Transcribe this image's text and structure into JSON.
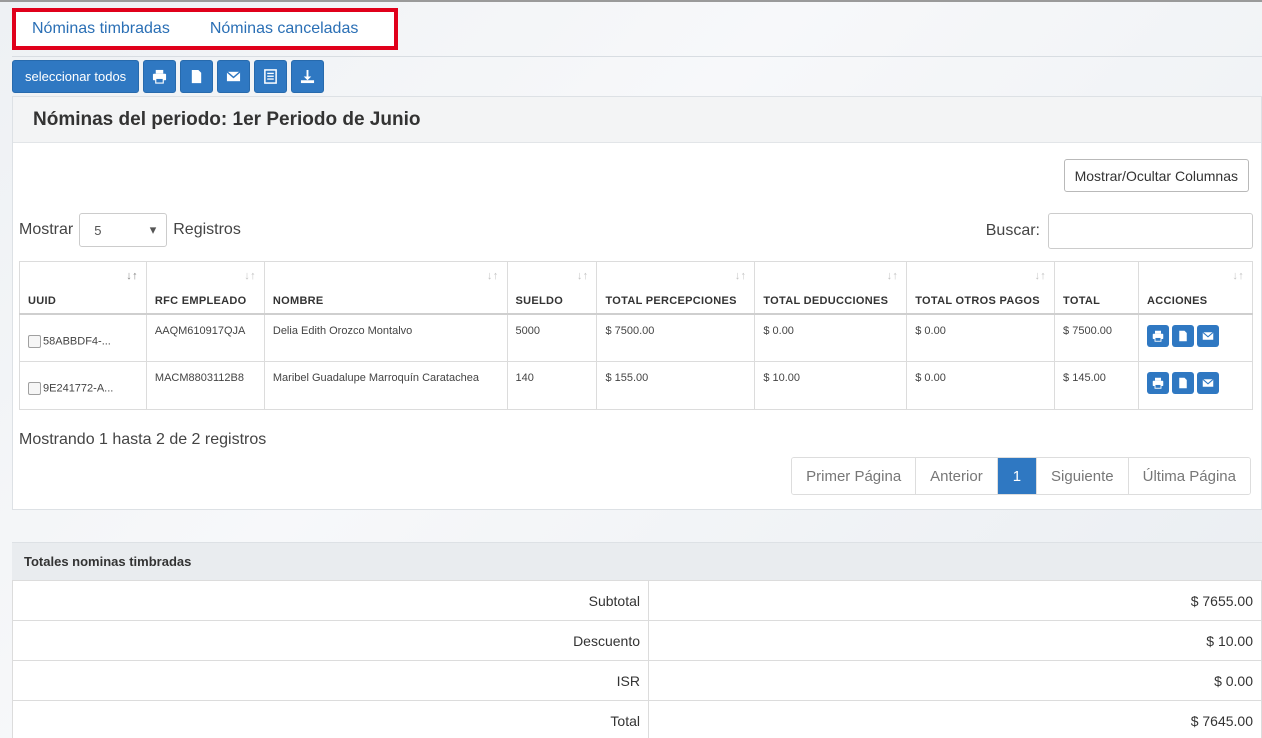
{
  "tabs": [
    {
      "label": "Nóminas timbradas"
    },
    {
      "label": "Nóminas canceladas"
    }
  ],
  "toolbar": {
    "select_all": "seleccionar todos",
    "icons": [
      "print-icon",
      "file-icon",
      "envelope-icon",
      "list-icon",
      "download-icon"
    ]
  },
  "panel": {
    "title": "Nóminas del periodo: 1er Periodo de Junio",
    "col_toggle": "Mostrar/Ocultar Columnas",
    "show_label": "Mostrar",
    "show_value": "5",
    "records_label": "Registros",
    "search_label": "Buscar:",
    "search_value": ""
  },
  "table": {
    "headers": [
      "UUID",
      "RFC EMPLEADO",
      "NOMBRE",
      "SUELDO",
      "TOTAL PERCEPCIONES",
      "TOTAL DEDUCCIONES",
      "TOTAL OTROS PAGOS",
      "TOTAL",
      "ACCIONES"
    ],
    "rows": [
      {
        "uuid": "58ABBDF4-...",
        "rfc": "AAQM610917QJA",
        "nombre": "Delia Edith Orozco Montalvo",
        "sueldo": "5000",
        "percepciones": "$ 7500.00",
        "deducciones": "$ 0.00",
        "otros": "$ 0.00",
        "total": "$ 7500.00"
      },
      {
        "uuid": "9E241772-A...",
        "rfc": "MACM8803112B8",
        "nombre": "Maribel Guadalupe Marroquín Caratachea",
        "sueldo": "140",
        "percepciones": "$ 155.00",
        "deducciones": "$ 10.00",
        "otros": "$ 0.00",
        "total": "$ 145.00"
      }
    ]
  },
  "info": "Mostrando 1 hasta 2 de 2 registros",
  "pager": {
    "first": "Primer Página",
    "prev": "Anterior",
    "current": "1",
    "next": "Siguiente",
    "last": "Última Página"
  },
  "totals": {
    "title": "Totales nominas timbradas",
    "rows": [
      {
        "label": "Subtotal",
        "value": "$ 7655.00"
      },
      {
        "label": "Descuento",
        "value": "$ 10.00"
      },
      {
        "label": "ISR",
        "value": "$ 0.00"
      },
      {
        "label": "Total",
        "value": "$ 7645.00"
      }
    ]
  },
  "colors": {
    "primary": "#2f78c2",
    "highlight": "#e0001b",
    "link": "#2a6fb5"
  }
}
